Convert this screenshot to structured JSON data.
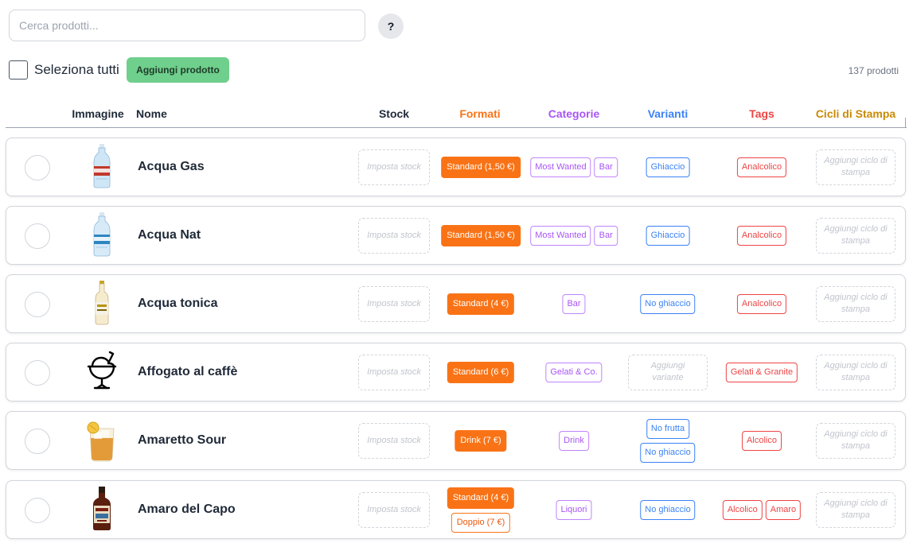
{
  "search": {
    "placeholder": "Cerca prodotti..."
  },
  "help_label": "?",
  "toolbar": {
    "select_all": "Seleziona tutti",
    "add_product": "Aggiungi prodotto",
    "count": "137 prodotti"
  },
  "columns": {
    "image": "Immagine",
    "name": "Nome",
    "stock": "Stock",
    "formati": "Formati",
    "categorie": "Categorie",
    "varianti": "Varianti",
    "tags": "Tags",
    "cicli": "Cicli di Stampa"
  },
  "placeholders": {
    "stock": "Imposta stock",
    "cicli": "Aggiungi ciclo di stampa",
    "varianti": "Aggiungi variante"
  },
  "colors": {
    "formati": "#f97316",
    "categorie": "#a855f7",
    "varianti": "#3b82f6",
    "tags": "#ef4444",
    "cicli": "#ca8a04",
    "add_button": "#6fcf8c"
  },
  "products": [
    {
      "name": "Acqua Gas",
      "image": "water-bottle-red-label",
      "formati": [
        "Standard (1,50 €)"
      ],
      "formati_secondary": "",
      "categorie": [
        "Most Wanted",
        "Bar"
      ],
      "varianti": [
        "Ghiaccio"
      ],
      "tags": [
        "Analcolico"
      ]
    },
    {
      "name": "Acqua Nat",
      "image": "water-bottle-blue-label",
      "formati": [
        "Standard (1,50 €)"
      ],
      "formati_secondary": "",
      "categorie": [
        "Most Wanted",
        "Bar"
      ],
      "varianti": [
        "Ghiaccio"
      ],
      "tags": [
        "Analcolico"
      ]
    },
    {
      "name": "Acqua tonica",
      "image": "tonic-bottle",
      "formati": [
        "Standard (4 €)"
      ],
      "formati_secondary": "",
      "categorie": [
        "Bar"
      ],
      "varianti": [
        "No ghiaccio"
      ],
      "tags": [
        "Analcolico"
      ]
    },
    {
      "name": "Affogato al caffè",
      "image": "ice-cream-cup-icon",
      "formati": [
        "Standard (6 €)"
      ],
      "formati_secondary": "",
      "categorie": [
        "Gelati & Co."
      ],
      "varianti": [],
      "tags": [
        "Gelati & Granite"
      ]
    },
    {
      "name": "Amaretto Sour",
      "image": "cocktail-glass",
      "formati": [
        "Drink (7 €)"
      ],
      "formati_secondary": "",
      "categorie": [
        "Drink"
      ],
      "varianti": [
        "No frutta",
        "No ghiaccio"
      ],
      "tags": [
        "Alcolico"
      ]
    },
    {
      "name": "Amaro del Capo",
      "image": "liqueur-bottle",
      "formati": [
        "Standard (4 €)"
      ],
      "formati_secondary": "Doppio (7 €)",
      "categorie": [
        "Liquori"
      ],
      "varianti": [
        "No ghiaccio"
      ],
      "tags": [
        "Alcolico",
        "Amaro"
      ]
    }
  ]
}
